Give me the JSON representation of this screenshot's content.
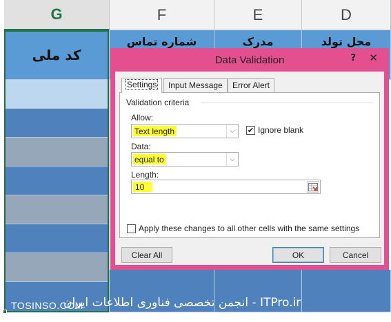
{
  "spreadsheet": {
    "columns": [
      "G",
      "F",
      "E",
      "D"
    ],
    "header_row": [
      "کد ملی",
      "شماره تماس",
      "مدرک",
      "محل تولد"
    ],
    "colors": {
      "header_fill": "#5b9bd5",
      "band_dark": "#4f81bd",
      "band_light": "#95a7b8",
      "selected_top": "#bdd7ee",
      "selection_border": "#217346"
    }
  },
  "dialog": {
    "title": "Data Validation",
    "help_glyph": "?",
    "close_glyph": "✕",
    "tabs": [
      {
        "label": "Settings",
        "active": true
      },
      {
        "label": "Input Message",
        "active": false
      },
      {
        "label": "Error Alert",
        "active": false
      }
    ],
    "group_label": "Validation criteria",
    "allow": {
      "label": "Allow:",
      "value": "Text length"
    },
    "ignore_blank": {
      "label": "Ignore blank",
      "checked": true
    },
    "data": {
      "label": "Data:",
      "value": "equal to"
    },
    "length": {
      "label": "Length:",
      "value": "10"
    },
    "apply_all": {
      "label": "Apply these changes to all other cells with the same settings",
      "checked": false
    },
    "buttons": {
      "clear_all": "Clear All",
      "ok": "OK",
      "cancel": "Cancel"
    },
    "colors": {
      "frame": "#e4508f",
      "highlight": "#ffff33"
    }
  },
  "footer": {
    "left_watermark": "TOSINSO.COM",
    "right_watermark": "ITPro.ir - انجمن تخصصی فناوری اطلاعات ایران"
  }
}
